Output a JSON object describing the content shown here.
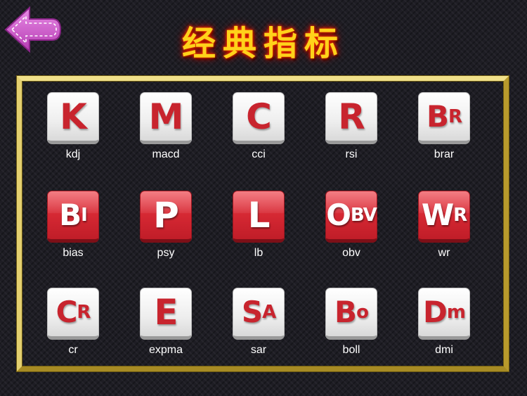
{
  "page": {
    "title": "经典指标"
  },
  "colors": {
    "accent_red": "#d52833",
    "frame_gold": "#d7c15a",
    "back_arrow": "#c94fc6"
  },
  "icons": {
    "back": "left-arrow-icon"
  },
  "indicators": [
    {
      "main": "K",
      "sub": "",
      "label": "kdj",
      "style": "white"
    },
    {
      "main": "M",
      "sub": "",
      "label": "macd",
      "style": "white"
    },
    {
      "main": "C",
      "sub": "",
      "label": "cci",
      "style": "white"
    },
    {
      "main": "R",
      "sub": "",
      "label": "rsi",
      "style": "white"
    },
    {
      "main": "B",
      "sub": "R",
      "label": "brar",
      "style": "white"
    },
    {
      "main": "B",
      "sub": "I",
      "label": "bias",
      "style": "red"
    },
    {
      "main": "P",
      "sub": "",
      "label": "psy",
      "style": "red"
    },
    {
      "main": "L",
      "sub": "",
      "label": "lb",
      "style": "red"
    },
    {
      "main": "O",
      "sub": "BV",
      "label": "obv",
      "style": "red"
    },
    {
      "main": "W",
      "sub": "R",
      "label": "wr",
      "style": "red"
    },
    {
      "main": "C",
      "sub": "R",
      "label": "cr",
      "style": "white"
    },
    {
      "main": "E",
      "sub": "",
      "label": "expma",
      "style": "white"
    },
    {
      "main": "S",
      "sub": "A",
      "label": "sar",
      "style": "white"
    },
    {
      "main": "B",
      "sub": "o",
      "label": "boll",
      "style": "white"
    },
    {
      "main": "D",
      "sub": "m",
      "label": "dmi",
      "style": "white"
    }
  ]
}
